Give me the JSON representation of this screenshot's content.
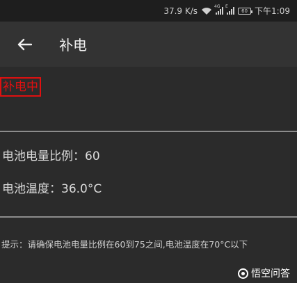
{
  "status_bar": {
    "net_speed": "37.9 K/s",
    "sim1_tag": "4G",
    "sim2_tag": "E",
    "battery": "60",
    "time": "下午1:09"
  },
  "app_bar": {
    "title": "补电"
  },
  "main": {
    "charging_status": "补电中",
    "battery_level": "电池电量比例：60",
    "battery_temp": "电池温度：36.0°C",
    "hint": "提示：请确保电池电量比例在60到75之间,电池温度在70°C以下"
  },
  "watermark": {
    "text": "悟空问答"
  },
  "colors": {
    "accent_red": "#e01010",
    "background": "#2b2b2b",
    "app_bar": "#333333"
  }
}
